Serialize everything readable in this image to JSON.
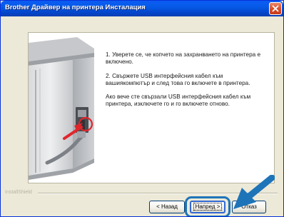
{
  "window": {
    "title": "Brother Драйвер на принтера Инсталация",
    "close_icon": "close-icon"
  },
  "instructions": {
    "step1": "1. Уверете се, че копчето на захранването на принтера е включено.",
    "step2": "2. Свържете USB интерфейсния кабел към вашиякомпютър и след това го включете в принтера.",
    "note": "Ако вече сте свързали USB интерфейсния кабел към принтера, изключете го и го включете отново."
  },
  "footer": {
    "brand": "InstallShield",
    "back_label": "< Назад",
    "next_label": "Напред >",
    "cancel_label": "Отказ"
  },
  "colors": {
    "titlebar": "#0a59f2",
    "arrow": "#1e74b8",
    "pointer": "#e0262c"
  }
}
